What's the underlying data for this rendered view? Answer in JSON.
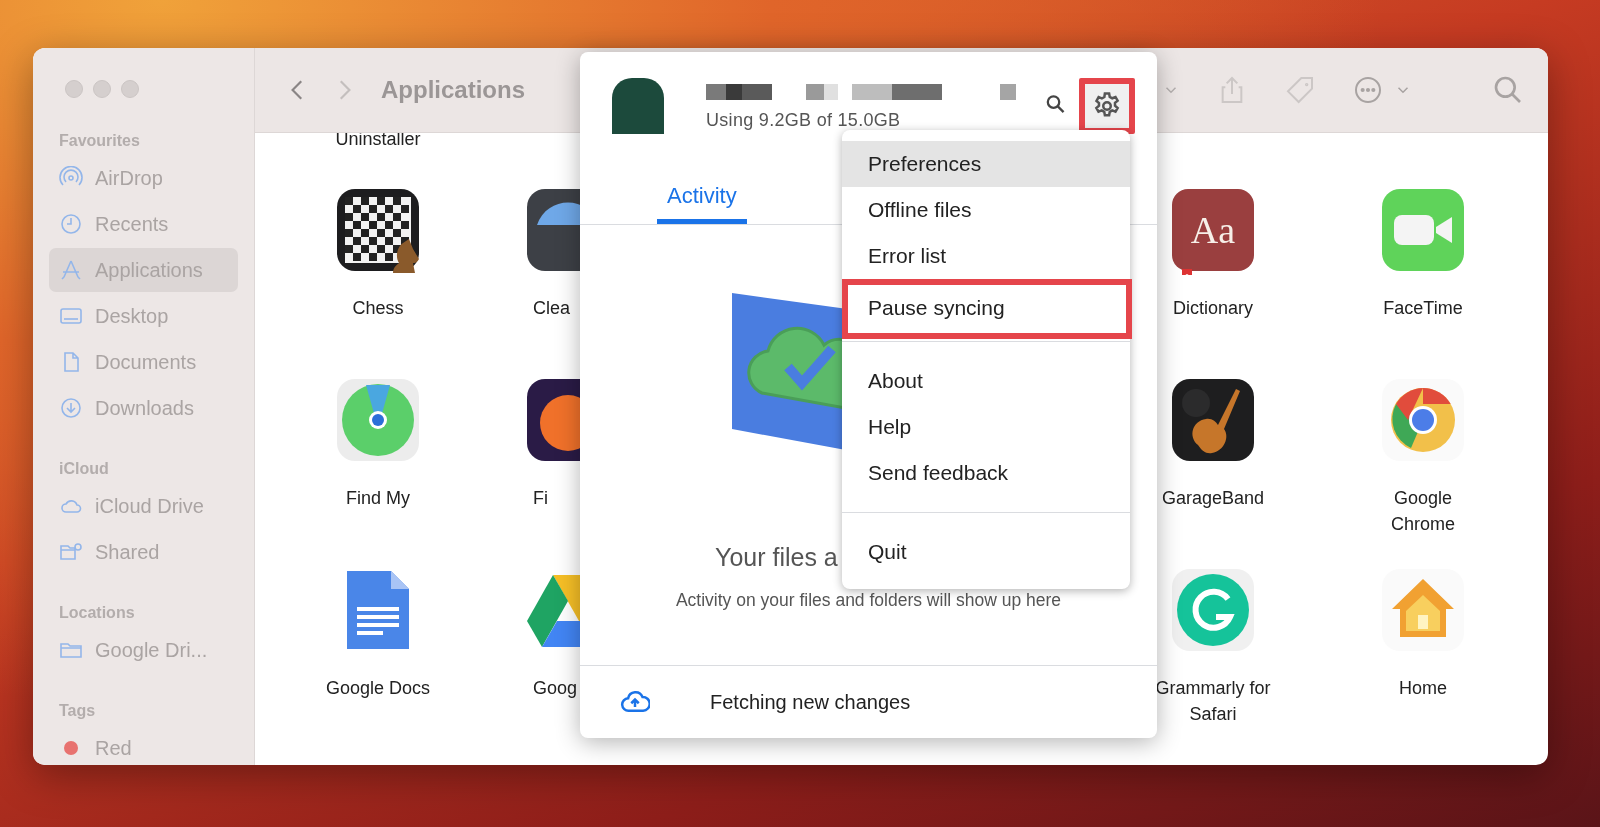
{
  "finder": {
    "toolbar": {
      "title": "Applications"
    },
    "sidebar": [
      {
        "heading": "Favourites",
        "items": [
          {
            "label": "AirDrop",
            "kind": "airdrop",
            "selected": false
          },
          {
            "label": "Recents",
            "kind": "clock",
            "selected": false
          },
          {
            "label": "Applications",
            "kind": "apps",
            "selected": true
          },
          {
            "label": "Desktop",
            "kind": "desktop",
            "selected": false
          },
          {
            "label": "Documents",
            "kind": "document",
            "selected": false
          },
          {
            "label": "Downloads",
            "kind": "download",
            "selected": false
          }
        ]
      },
      {
        "heading": "iCloud",
        "items": [
          {
            "label": "iCloud Drive",
            "kind": "cloud",
            "selected": false
          },
          {
            "label": "Shared",
            "kind": "shared",
            "selected": false
          }
        ]
      },
      {
        "heading": "Locations",
        "items": [
          {
            "label": "Google Dri...",
            "kind": "folder",
            "selected": false
          }
        ]
      },
      {
        "heading": "Tags",
        "items": [
          {
            "label": "Red",
            "kind": "tag",
            "color": "#e8726f",
            "selected": false
          }
        ]
      }
    ],
    "apps": {
      "cut_top_label": "Uninstaller",
      "rows": [
        [
          {
            "label": "Chess"
          },
          {
            "label": "Clea"
          },
          {
            "label": "Dictionary",
            "icon_text": "Aa"
          },
          {
            "label": "FaceTime"
          }
        ],
        [
          {
            "label": "Find My"
          },
          {
            "label": "Fi"
          },
          {
            "label": "GarageBand"
          },
          {
            "label": "Google Chrome"
          }
        ],
        [
          {
            "label": "Google Docs"
          },
          {
            "label": "Goog"
          },
          {
            "label": "Grammarly for Safari"
          },
          {
            "label": "Home"
          }
        ]
      ]
    }
  },
  "drive_popup": {
    "storage": "Using 9.2GB of 15.0GB",
    "settings_annotated": true,
    "tabs": [
      {
        "label": "Activity",
        "selected": true
      }
    ],
    "heading": "Your files a",
    "message": "Activity on your files and folders will show up here",
    "footer": "Fetching new changes",
    "menu": [
      [
        {
          "label": "Preferences",
          "selected": true,
          "annotated": false
        },
        {
          "label": "Offline files",
          "selected": false,
          "annotated": false
        },
        {
          "label": "Error list",
          "selected": false,
          "annotated": false
        },
        {
          "label": "Pause syncing",
          "selected": false,
          "annotated": true
        }
      ],
      [
        {
          "label": "About",
          "selected": false,
          "annotated": false
        },
        {
          "label": "Help",
          "selected": false,
          "annotated": false
        },
        {
          "label": "Send feedback",
          "selected": false,
          "annotated": false
        }
      ],
      [
        {
          "label": "Quit",
          "selected": false,
          "annotated": false
        }
      ]
    ]
  }
}
